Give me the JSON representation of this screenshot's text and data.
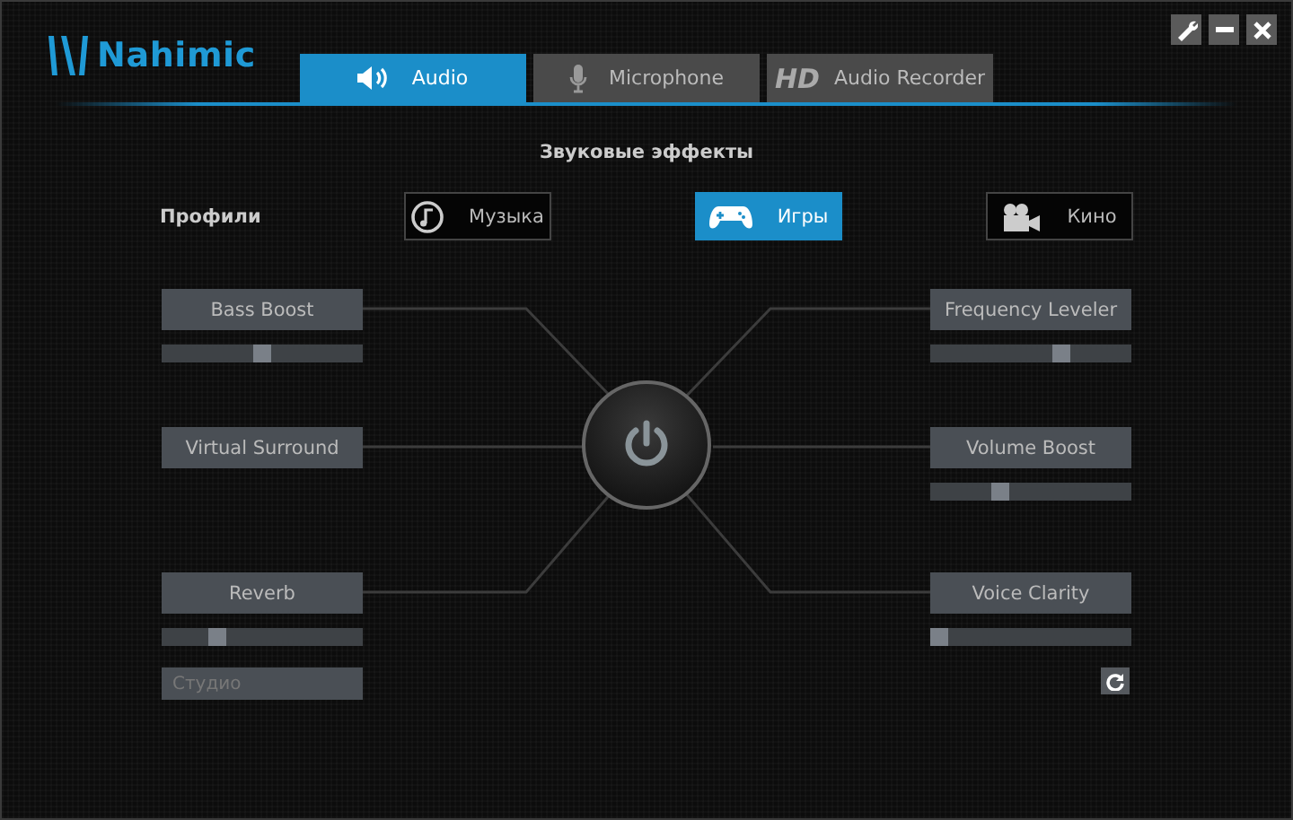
{
  "app": {
    "name": "Nahimic"
  },
  "tabs": [
    {
      "label": "Audio",
      "selected": true
    },
    {
      "label": "Microphone",
      "selected": false
    },
    {
      "label": "Audio Recorder",
      "badge": "HD",
      "selected": false
    }
  ],
  "section_title": "Звуковые эффекты",
  "profiles": {
    "label": "Профили",
    "items": [
      {
        "label": "Музыка",
        "selected": false
      },
      {
        "label": "Игры",
        "selected": true
      },
      {
        "label": "Кино",
        "selected": false
      }
    ]
  },
  "left_effects": [
    {
      "label": "Bass Boost",
      "kind": "slider",
      "level": 0.5
    },
    {
      "label": "Virtual Surround",
      "kind": "button"
    },
    {
      "label": "Reverb",
      "kind": "slider",
      "level": 0.25
    }
  ],
  "reverb_preset": {
    "value": "Студио",
    "disabled": true
  },
  "right_effects": [
    {
      "label": "Frequency Leveler",
      "kind": "slider",
      "level": 0.67
    },
    {
      "label": "Volume Boost",
      "kind": "slider",
      "level": 0.33
    },
    {
      "label": "Voice Clarity",
      "kind": "slider",
      "level": 0
    }
  ]
}
